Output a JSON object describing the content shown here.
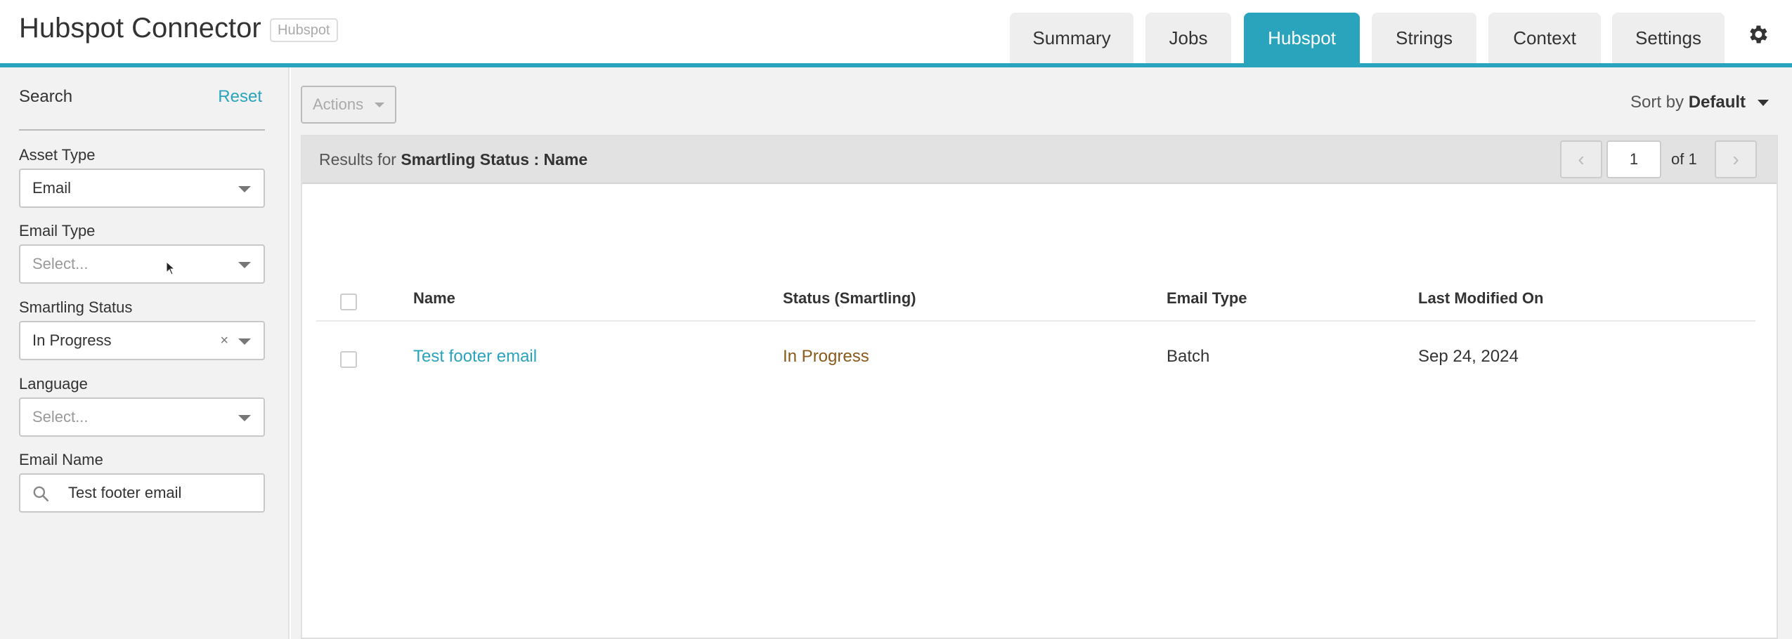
{
  "header": {
    "title": "Hubspot Connector",
    "badge": "Hubspot",
    "tabs": [
      {
        "label": "Summary",
        "active": false
      },
      {
        "label": "Jobs",
        "active": false
      },
      {
        "label": "Hubspot",
        "active": true
      },
      {
        "label": "Strings",
        "active": false
      },
      {
        "label": "Context",
        "active": false
      },
      {
        "label": "Settings",
        "active": false
      }
    ],
    "settings_icon": "gear-icon",
    "accent_color": "#2aa3bd"
  },
  "sidebar": {
    "search_label": "Search",
    "reset_label": "Reset",
    "filters": {
      "asset_type": {
        "label": "Asset Type",
        "value": "Email"
      },
      "email_type": {
        "label": "Email Type",
        "placeholder": "Select..."
      },
      "smartling_status": {
        "label": "Smartling Status",
        "value": "In Progress",
        "clear": "×"
      },
      "language": {
        "label": "Language",
        "placeholder": "Select..."
      },
      "email_name": {
        "label": "Email Name",
        "value": "Test footer email",
        "icon": "search-icon"
      }
    }
  },
  "main": {
    "actions_label": "Actions",
    "sort": {
      "label": "Sort by",
      "value": "Default"
    },
    "results": {
      "prefix": "Results for",
      "filter_field": "Smartling Status",
      "separator": ":",
      "filter_value": "Name"
    },
    "pagination": {
      "prev": "‹",
      "page": "1",
      "of": "of 1",
      "next": "›"
    },
    "table": {
      "columns": [
        "Name",
        "Status (Smartling)",
        "Email Type",
        "Last Modified On"
      ],
      "rows": [
        {
          "name": "Test footer email",
          "status": "In Progress",
          "email_type": "Batch",
          "modified": "Sep 24, 2024"
        }
      ]
    }
  }
}
